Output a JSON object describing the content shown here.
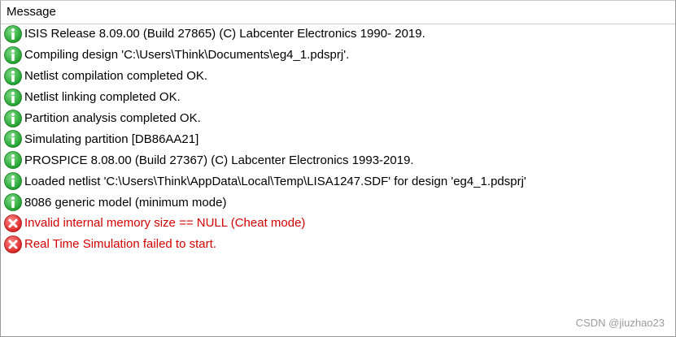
{
  "header": {
    "title": "Message"
  },
  "messages": [
    {
      "type": "info",
      "icon": "info-icon",
      "text": "ISIS Release 8.09.00 (Build 27865) (C) Labcenter Electronics 1990- 2019."
    },
    {
      "type": "info",
      "icon": "info-icon",
      "text": "Compiling design 'C:\\Users\\Think\\Documents\\eg4_1.pdsprj'."
    },
    {
      "type": "info",
      "icon": "info-icon",
      "text": "Netlist compilation completed OK."
    },
    {
      "type": "info",
      "icon": "info-icon",
      "text": "Netlist linking completed OK."
    },
    {
      "type": "info",
      "icon": "info-icon",
      "text": "Partition analysis completed OK."
    },
    {
      "type": "info",
      "icon": "info-icon",
      "text": "Simulating partition [DB86AA21]"
    },
    {
      "type": "info",
      "icon": "info-icon",
      "text": "PROSPICE 8.08.00 (Build 27367) (C) Labcenter Electronics 1993-2019."
    },
    {
      "type": "info",
      "icon": "info-icon",
      "text": "Loaded netlist 'C:\\Users\\Think\\AppData\\Local\\Temp\\LISA1247.SDF' for design 'eg4_1.pdsprj'"
    },
    {
      "type": "info",
      "icon": "info-icon",
      "text": "8086 generic model (minimum mode)"
    },
    {
      "type": "error",
      "icon": "error-icon",
      "text": "Invalid internal memory size == NULL (Cheat mode)"
    },
    {
      "type": "error",
      "icon": "error-icon",
      "text": "Real Time Simulation failed to start."
    }
  ],
  "watermark": "CSDN @jiuzhao23",
  "colors": {
    "info_icon": "#1e9e2c",
    "error_icon": "#d92020",
    "error_text": "#d40000"
  }
}
